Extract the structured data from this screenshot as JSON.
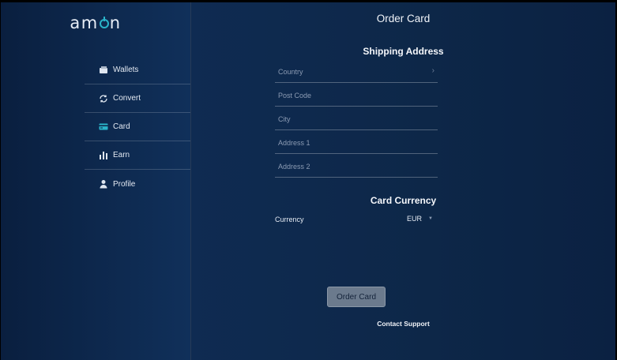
{
  "sidebar": {
    "logo_prefix": "am",
    "logo_suffix": "n",
    "items": [
      {
        "label": "Wallets",
        "icon": "wallet-icon"
      },
      {
        "label": "Convert",
        "icon": "convert-icon"
      },
      {
        "label": "Card",
        "icon": "card-icon"
      },
      {
        "label": "Earn",
        "icon": "bar-chart-icon"
      },
      {
        "label": "Profile",
        "icon": "user-icon"
      }
    ]
  },
  "main": {
    "title": "Order Card",
    "shipping": {
      "heading": "Shipping Address",
      "country_placeholder": "Country",
      "postcode_placeholder": "Post Code",
      "city_placeholder": "City",
      "address1_placeholder": "Address 1",
      "address2_placeholder": "Address 2"
    },
    "currency": {
      "heading": "Card Currency",
      "label": "Currency",
      "value": "EUR"
    },
    "order_button": "Order Card",
    "support_link": "Contact Support"
  },
  "colors": {
    "accent": "#2ab3c9",
    "background": "#0d2748",
    "button": "#6b7a8d"
  }
}
